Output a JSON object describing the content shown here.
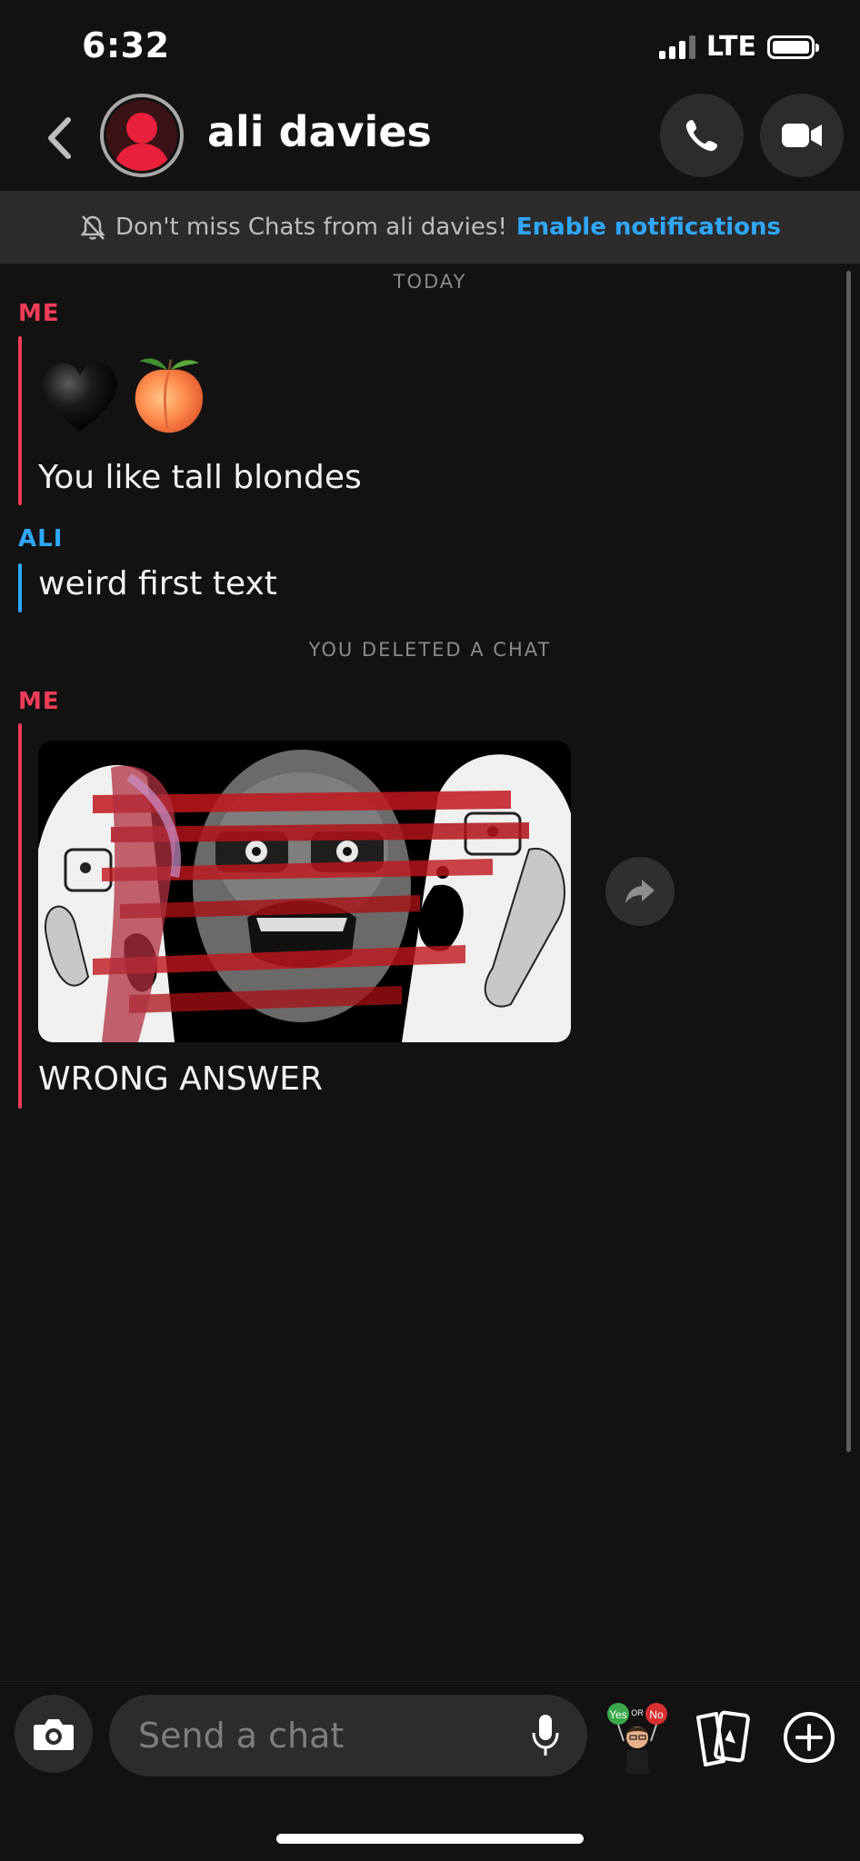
{
  "status_bar": {
    "time": "6:32",
    "network": "LTE"
  },
  "header": {
    "back_icon": "chevron-left-icon",
    "contact_name": "ali davies",
    "call_icon": "phone-icon",
    "video_icon": "video-camera-icon"
  },
  "notification_banner": {
    "icon": "bell-off-icon",
    "text": "Don't miss Chats from ali davies!",
    "link": "Enable notifications"
  },
  "chat": {
    "date_label": "TODAY",
    "deleted_label": "YOU DELETED A CHAT",
    "messages": [
      {
        "sender": "ME",
        "emoji": "black-heart peach",
        "text": "You like tall blondes"
      },
      {
        "sender": "ALI",
        "text": "weird first text"
      },
      {
        "sender": "ME",
        "media": "meme-image",
        "text": "WRONG ANSWER"
      }
    ]
  },
  "composer": {
    "placeholder": "Send a chat",
    "bitmoji_sign_yes": "Yes",
    "bitmoji_sign_or": "OR",
    "bitmoji_sign_no": "No"
  },
  "colors": {
    "background": "#121212",
    "me_accent": "#f23c57",
    "ali_accent": "#2ea8ff",
    "banner_bg": "#2b2b2b",
    "link": "#2ea8ff"
  }
}
